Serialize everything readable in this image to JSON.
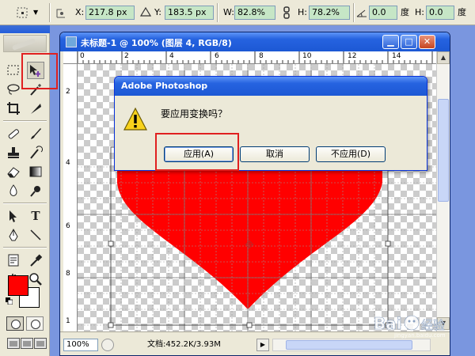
{
  "options_bar": {
    "x_label": "X:",
    "x_value": "217.8 px",
    "delta_icon": "triangle-icon",
    "y_label": "Y:",
    "y_value": "183.5 px",
    "w_label": "W:",
    "w_value": "82.8%",
    "link_icon": "chain-link-icon",
    "h_label": "H:",
    "h_value": "78.2%",
    "rotate_value": "0.0",
    "rotate_unit": "度",
    "hskew_label": "H:",
    "hskew_value": "0.0",
    "hskew_unit": "度"
  },
  "document": {
    "title": "未标题-1 @ 100% (图层 4, RGB/8)",
    "hruler_labels": [
      "0",
      "2",
      "4",
      "6",
      "8",
      "10",
      "12",
      "14"
    ],
    "vruler_labels": [
      "2",
      "4",
      "6",
      "8",
      "1"
    ],
    "zoom": "100%",
    "status": "文档:452.2K/3.93M"
  },
  "dialog": {
    "title": "Adobe Photoshop",
    "message": "要应用变换吗？",
    "apply_label": "应用(A)",
    "cancel_label": "取消",
    "dont_apply_label": "不应用(D)"
  },
  "colors": {
    "foreground": "#ff0000",
    "background": "#ffffff",
    "highlight": "#e02020",
    "heart": "#ff0000"
  },
  "watermark": {
    "brand": "Bai",
    "suffix": "经验",
    "domain": "jingyan.baidu.com"
  }
}
